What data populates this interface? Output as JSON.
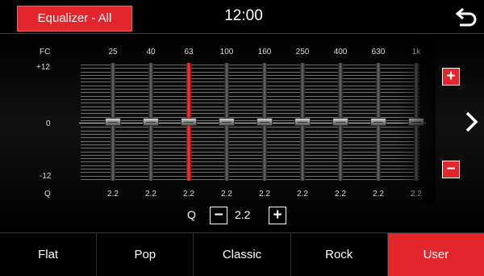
{
  "header": {
    "title": "Equalizer - All",
    "clock": "12:00",
    "back_icon": "back-arrow-icon"
  },
  "labels": {
    "fc": "FC",
    "top": "+12",
    "mid": "0",
    "bottom": "-12",
    "q": "Q"
  },
  "bands": [
    {
      "freq": "25",
      "q": "2.2",
      "gain_db": 0,
      "selected": false
    },
    {
      "freq": "40",
      "q": "2.2",
      "gain_db": 0,
      "selected": false
    },
    {
      "freq": "63",
      "q": "2.2",
      "gain_db": 0,
      "selected": true
    },
    {
      "freq": "100",
      "q": "2.2",
      "gain_db": 0,
      "selected": false
    },
    {
      "freq": "160",
      "q": "2.2",
      "gain_db": 0,
      "selected": false
    },
    {
      "freq": "250",
      "q": "2.2",
      "gain_db": 0,
      "selected": false
    },
    {
      "freq": "400",
      "q": "2.2",
      "gain_db": 0,
      "selected": false
    },
    {
      "freq": "630",
      "q": "2.2",
      "gain_db": 0,
      "selected": false
    },
    {
      "freq": "1k",
      "q": "2.2",
      "gain_db": 0,
      "selected": false
    }
  ],
  "gain_buttons": {
    "plus": "+",
    "minus": "−"
  },
  "q_control": {
    "label": "Q",
    "minus": "−",
    "value": "2.2",
    "plus": "+"
  },
  "next_icon": "chevron-right-icon",
  "presets": [
    "Flat",
    "Pop",
    "Classic",
    "Rock",
    "User"
  ],
  "active_preset": "User",
  "colors": {
    "accent": "#e3262c",
    "background": "#000000"
  }
}
